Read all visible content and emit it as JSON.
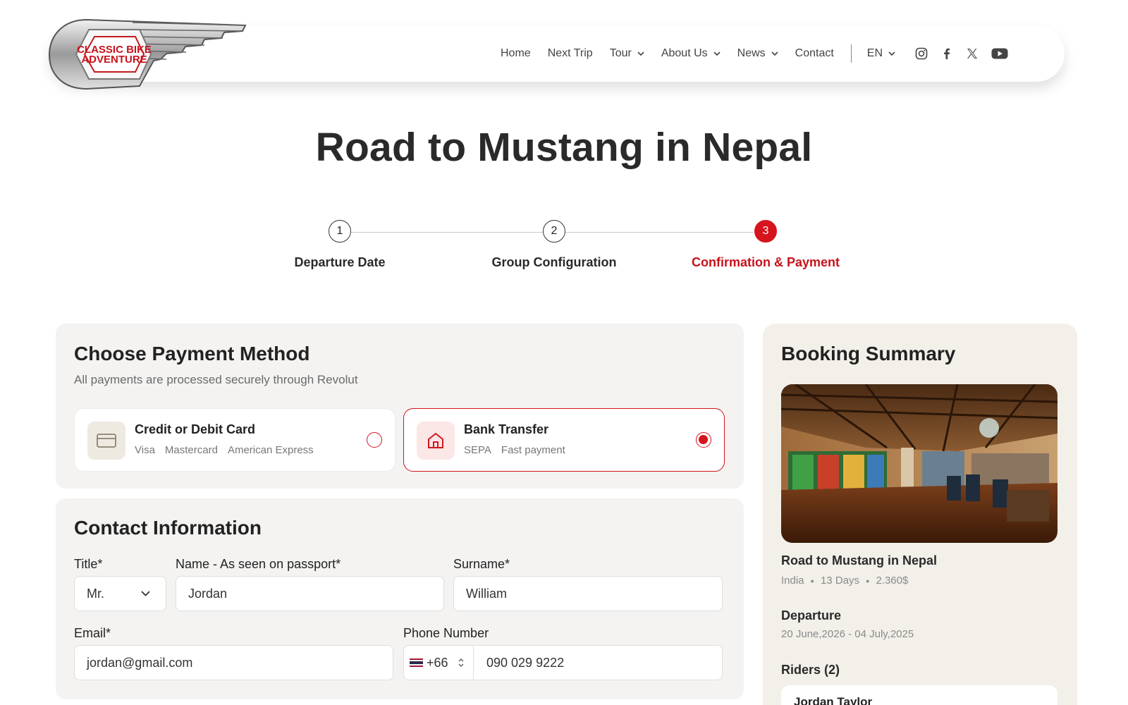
{
  "brand": {
    "logo_line1": "CLASSIC BIKE",
    "logo_line2": "ADVENTURE"
  },
  "nav": {
    "items": [
      {
        "label": "Home",
        "dropdown": false
      },
      {
        "label": "Next Trip",
        "dropdown": false
      },
      {
        "label": "Tour",
        "dropdown": true
      },
      {
        "label": "About Us",
        "dropdown": true
      },
      {
        "label": "News",
        "dropdown": true
      },
      {
        "label": "Contact",
        "dropdown": false
      }
    ],
    "language": "EN",
    "social_icons": [
      "instagram-icon",
      "facebook-icon",
      "x-icon",
      "youtube-icon"
    ]
  },
  "page": {
    "title": "Road to Mustang in Nepal"
  },
  "stepper": {
    "steps": [
      {
        "number": "1",
        "label": "Departure Date"
      },
      {
        "number": "2",
        "label": "Group Configuration"
      },
      {
        "number": "3",
        "label": "Confirmation & Payment"
      }
    ],
    "active_step": 3
  },
  "payment": {
    "title": "Choose Payment Method",
    "subtitle": "All payments are processed securely through Revolut",
    "options": [
      {
        "title": "Credit or Debit Card",
        "tags": [
          "Visa",
          "Mastercard",
          "American Express"
        ],
        "selected": false,
        "icon": "credit-card-icon"
      },
      {
        "title": "Bank Transfer",
        "tags": [
          "SEPA",
          "Fast payment"
        ],
        "selected": true,
        "icon": "bank-icon"
      }
    ]
  },
  "contact": {
    "title": "Contact Information",
    "title_label": "Title*",
    "title_value": "Mr.",
    "name_label": "Name - As seen on passport*",
    "name_value": "Jordan",
    "surname_label": "Surname*",
    "surname_value": "William",
    "email_label": "Email*",
    "email_value": "jordan@gmail.com",
    "phone_label": "Phone Number",
    "phone_code": "+66",
    "phone_value": "090 029 9222"
  },
  "summary": {
    "title": "Booking Summary",
    "trip_name": "Road to Mustang in Nepal",
    "country": "India",
    "duration": "13 Days",
    "price": "2.360$",
    "departure_label": "Departure",
    "departure_dates": "20 June,2026 - 04 July,2025",
    "riders_label": "Riders (2)",
    "first_rider": "Jordan Taylor"
  },
  "colors": {
    "accent": "#d6141e",
    "panel_bg": "#f4f3f2",
    "summary_bg": "#f3f0ea"
  }
}
